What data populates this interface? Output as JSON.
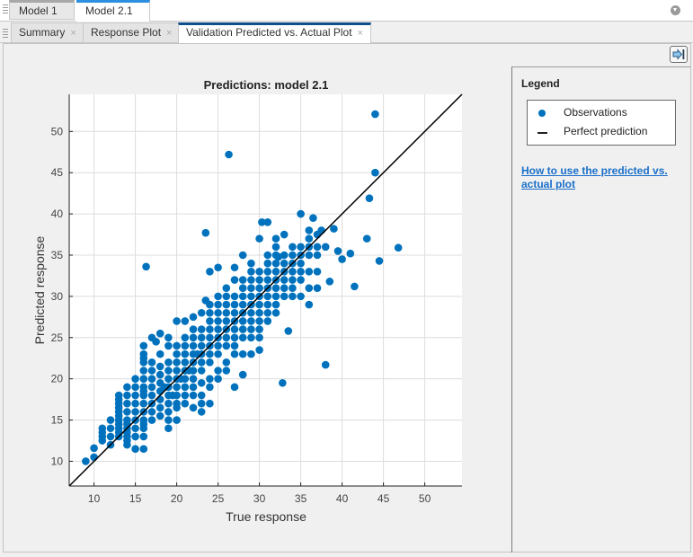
{
  "doc_tabs": [
    {
      "label": "Model 1",
      "active": false
    },
    {
      "label": "Model 2.1",
      "active": true
    }
  ],
  "plot_tabs": [
    {
      "label": "Summary",
      "active": false,
      "close": "×"
    },
    {
      "label": "Response Plot",
      "active": false,
      "close": "×"
    },
    {
      "label": "Validation Predicted vs. Actual Plot",
      "active": true,
      "close": "×"
    }
  ],
  "legend": {
    "title": "Legend",
    "items": [
      {
        "label": "Observations",
        "marker": "dot",
        "color": "#0072bd"
      },
      {
        "label": "Perfect prediction",
        "marker": "line",
        "color": "#000000"
      }
    ],
    "help_link": "How to use the predicted vs. actual plot"
  },
  "icons": {
    "doc_menu": "dropdown-circle-icon",
    "collapse": "arrow-right-to-bar-icon"
  },
  "chart_data": {
    "type": "scatter",
    "title": "Predictions: model 2.1",
    "xlabel": "True response",
    "ylabel": "Predicted response",
    "xlim": [
      7,
      54.5
    ],
    "ylim": [
      7,
      54.5
    ],
    "xticks": [
      10,
      15,
      20,
      25,
      30,
      35,
      40,
      45,
      50
    ],
    "yticks": [
      10,
      15,
      20,
      25,
      30,
      35,
      40,
      45,
      50
    ],
    "grid": true,
    "series": [
      {
        "name": "Observations",
        "color": "#0072bd",
        "type": "scatter",
        "points": [
          [
            9,
            10
          ],
          [
            10,
            10.5
          ],
          [
            10,
            11.6
          ],
          [
            11,
            12.5
          ],
          [
            11,
            13
          ],
          [
            11,
            13.5
          ],
          [
            11,
            14
          ],
          [
            12,
            12
          ],
          [
            12,
            13
          ],
          [
            12,
            14
          ],
          [
            12,
            15
          ],
          [
            13,
            13
          ],
          [
            13,
            13.5
          ],
          [
            13,
            14
          ],
          [
            13,
            14.5
          ],
          [
            13,
            15
          ],
          [
            13,
            15.5
          ],
          [
            13,
            16
          ],
          [
            13,
            16.5
          ],
          [
            13,
            17
          ],
          [
            13,
            17.5
          ],
          [
            13,
            18
          ],
          [
            14,
            12
          ],
          [
            14,
            12.5
          ],
          [
            14,
            13
          ],
          [
            14,
            13.5
          ],
          [
            14,
            14
          ],
          [
            14,
            14.5
          ],
          [
            14,
            15
          ],
          [
            14,
            16
          ],
          [
            14,
            17
          ],
          [
            14,
            18
          ],
          [
            14,
            19
          ],
          [
            15,
            11.5
          ],
          [
            15,
            13
          ],
          [
            15,
            14
          ],
          [
            15,
            15
          ],
          [
            15,
            16
          ],
          [
            15,
            17
          ],
          [
            15,
            18
          ],
          [
            15,
            19
          ],
          [
            15,
            20
          ],
          [
            16,
            11.5
          ],
          [
            16,
            13
          ],
          [
            16,
            14
          ],
          [
            16,
            14.5
          ],
          [
            16,
            15
          ],
          [
            16,
            16
          ],
          [
            16,
            17
          ],
          [
            16,
            18
          ],
          [
            16,
            18.5
          ],
          [
            16,
            19
          ],
          [
            16,
            20
          ],
          [
            16,
            21
          ],
          [
            16,
            22
          ],
          [
            16,
            22.5
          ],
          [
            16,
            23
          ],
          [
            16,
            24
          ],
          [
            16.3,
            33.6
          ],
          [
            17,
            15
          ],
          [
            17,
            16
          ],
          [
            17,
            17
          ],
          [
            17,
            18
          ],
          [
            17,
            19
          ],
          [
            17,
            20
          ],
          [
            17,
            21
          ],
          [
            17,
            22
          ],
          [
            17,
            25
          ],
          [
            17.5,
            24.5
          ],
          [
            18,
            15.5
          ],
          [
            18,
            16.5
          ],
          [
            18,
            17.5
          ],
          [
            18,
            18.5
          ],
          [
            18,
            19.5
          ],
          [
            18,
            20.5
          ],
          [
            18,
            21.5
          ],
          [
            18,
            23
          ],
          [
            18,
            25.5
          ],
          [
            18.5,
            19
          ],
          [
            19,
            14
          ],
          [
            19,
            15
          ],
          [
            19,
            16
          ],
          [
            19,
            17
          ],
          [
            19,
            18
          ],
          [
            19,
            19
          ],
          [
            19,
            20
          ],
          [
            19,
            21
          ],
          [
            19,
            22
          ],
          [
            19,
            24
          ],
          [
            19,
            25
          ],
          [
            19.5,
            18
          ],
          [
            20,
            15
          ],
          [
            20,
            16.5
          ],
          [
            20,
            17
          ],
          [
            20,
            18
          ],
          [
            20,
            19
          ],
          [
            20,
            20
          ],
          [
            20,
            21
          ],
          [
            20,
            22
          ],
          [
            20,
            23
          ],
          [
            20,
            24
          ],
          [
            20,
            27
          ],
          [
            20.5,
            20
          ],
          [
            21,
            17
          ],
          [
            21,
            18
          ],
          [
            21,
            19
          ],
          [
            21,
            20
          ],
          [
            21,
            21
          ],
          [
            21,
            22
          ],
          [
            21,
            23
          ],
          [
            21,
            24
          ],
          [
            21,
            25
          ],
          [
            21,
            27
          ],
          [
            21.5,
            21
          ],
          [
            22,
            16.5
          ],
          [
            22,
            18
          ],
          [
            22,
            19
          ],
          [
            22,
            20
          ],
          [
            22,
            21
          ],
          [
            22,
            22
          ],
          [
            22,
            23
          ],
          [
            22,
            24
          ],
          [
            22,
            25
          ],
          [
            22,
            26
          ],
          [
            22,
            27.5
          ],
          [
            22.5,
            23
          ],
          [
            23,
            16
          ],
          [
            23,
            17
          ],
          [
            23,
            18
          ],
          [
            23,
            19.5
          ],
          [
            23,
            21
          ],
          [
            23,
            22
          ],
          [
            23,
            23
          ],
          [
            23,
            24
          ],
          [
            23,
            25
          ],
          [
            23,
            26
          ],
          [
            23,
            28
          ],
          [
            23.5,
            29.5
          ],
          [
            23.5,
            37.7
          ],
          [
            24,
            17
          ],
          [
            24,
            19
          ],
          [
            24,
            20
          ],
          [
            24,
            22
          ],
          [
            24,
            23
          ],
          [
            24,
            24
          ],
          [
            24,
            25
          ],
          [
            24,
            26
          ],
          [
            24,
            27
          ],
          [
            24,
            28
          ],
          [
            24,
            29
          ],
          [
            24,
            33
          ],
          [
            25,
            20
          ],
          [
            25,
            21
          ],
          [
            25,
            23
          ],
          [
            25,
            24
          ],
          [
            25,
            25
          ],
          [
            25,
            26
          ],
          [
            25,
            27
          ],
          [
            25,
            28
          ],
          [
            25,
            29
          ],
          [
            25,
            30
          ],
          [
            25,
            33.5
          ],
          [
            26,
            21
          ],
          [
            26,
            22
          ],
          [
            26,
            24
          ],
          [
            26,
            25
          ],
          [
            26,
            26
          ],
          [
            26,
            27
          ],
          [
            26,
            28
          ],
          [
            26,
            29
          ],
          [
            26,
            30
          ],
          [
            26,
            31
          ],
          [
            26.3,
            47.2
          ],
          [
            27,
            19
          ],
          [
            27,
            23
          ],
          [
            27,
            24
          ],
          [
            27,
            25
          ],
          [
            27,
            26
          ],
          [
            27,
            27
          ],
          [
            27,
            28
          ],
          [
            27,
            29
          ],
          [
            27,
            30
          ],
          [
            27,
            32
          ],
          [
            27,
            33.5
          ],
          [
            28,
            20.5
          ],
          [
            28,
            23
          ],
          [
            28,
            25
          ],
          [
            28,
            26
          ],
          [
            28,
            27
          ],
          [
            28,
            28
          ],
          [
            28,
            29
          ],
          [
            28,
            30
          ],
          [
            28,
            31
          ],
          [
            28,
            32
          ],
          [
            28,
            35
          ],
          [
            29,
            23
          ],
          [
            29,
            25
          ],
          [
            29,
            26
          ],
          [
            29,
            27
          ],
          [
            29,
            28
          ],
          [
            29,
            29
          ],
          [
            29,
            30
          ],
          [
            29,
            31
          ],
          [
            29,
            32
          ],
          [
            29,
            33
          ],
          [
            29,
            34
          ],
          [
            30,
            23.5
          ],
          [
            30,
            25
          ],
          [
            30,
            26
          ],
          [
            30,
            27
          ],
          [
            30,
            28
          ],
          [
            30,
            29
          ],
          [
            30,
            30
          ],
          [
            30,
            31
          ],
          [
            30,
            32
          ],
          [
            30,
            33
          ],
          [
            30,
            37
          ],
          [
            30.3,
            39
          ],
          [
            31,
            27
          ],
          [
            31,
            28
          ],
          [
            31,
            29
          ],
          [
            31,
            30
          ],
          [
            31,
            31
          ],
          [
            31,
            32
          ],
          [
            31,
            33
          ],
          [
            31,
            34
          ],
          [
            31,
            35
          ],
          [
            31,
            39
          ],
          [
            32,
            28
          ],
          [
            32,
            29
          ],
          [
            32,
            30
          ],
          [
            32,
            31
          ],
          [
            32,
            32
          ],
          [
            32,
            33
          ],
          [
            32,
            34
          ],
          [
            32,
            35
          ],
          [
            32,
            36
          ],
          [
            32,
            37
          ],
          [
            32.3,
            34.8
          ],
          [
            32.8,
            19.5
          ],
          [
            33,
            30
          ],
          [
            33,
            31
          ],
          [
            33,
            32
          ],
          [
            33,
            33
          ],
          [
            33,
            34
          ],
          [
            33,
            35
          ],
          [
            33,
            37.5
          ],
          [
            33.5,
            25.8
          ],
          [
            34,
            30
          ],
          [
            34,
            31
          ],
          [
            34,
            32
          ],
          [
            34,
            33
          ],
          [
            34,
            34
          ],
          [
            34,
            35
          ],
          [
            34,
            36
          ],
          [
            35,
            30
          ],
          [
            35,
            32
          ],
          [
            35,
            33
          ],
          [
            35,
            34
          ],
          [
            35,
            35
          ],
          [
            35,
            36
          ],
          [
            35,
            40
          ],
          [
            36,
            29
          ],
          [
            36,
            31
          ],
          [
            36,
            33
          ],
          [
            36,
            35
          ],
          [
            36,
            36
          ],
          [
            36,
            37
          ],
          [
            36,
            38
          ],
          [
            36.5,
            39.5
          ],
          [
            37,
            31
          ],
          [
            37,
            33
          ],
          [
            37,
            35
          ],
          [
            37,
            36
          ],
          [
            37,
            37.5
          ],
          [
            37.5,
            38
          ],
          [
            38,
            21.7
          ],
          [
            38,
            36
          ],
          [
            38.5,
            31.8
          ],
          [
            39,
            38.2
          ],
          [
            39.5,
            35.5
          ],
          [
            40,
            34.5
          ],
          [
            41,
            35.2
          ],
          [
            41.5,
            31.2
          ],
          [
            43,
            37
          ],
          [
            43.3,
            41.9
          ],
          [
            44,
            45
          ],
          [
            44,
            52.1
          ],
          [
            44.5,
            34.3
          ],
          [
            46.8,
            35.9
          ]
        ]
      },
      {
        "name": "Perfect prediction",
        "color": "#000000",
        "type": "line",
        "x": [
          7,
          54.5
        ],
        "y": [
          7,
          54.5
        ]
      }
    ]
  }
}
